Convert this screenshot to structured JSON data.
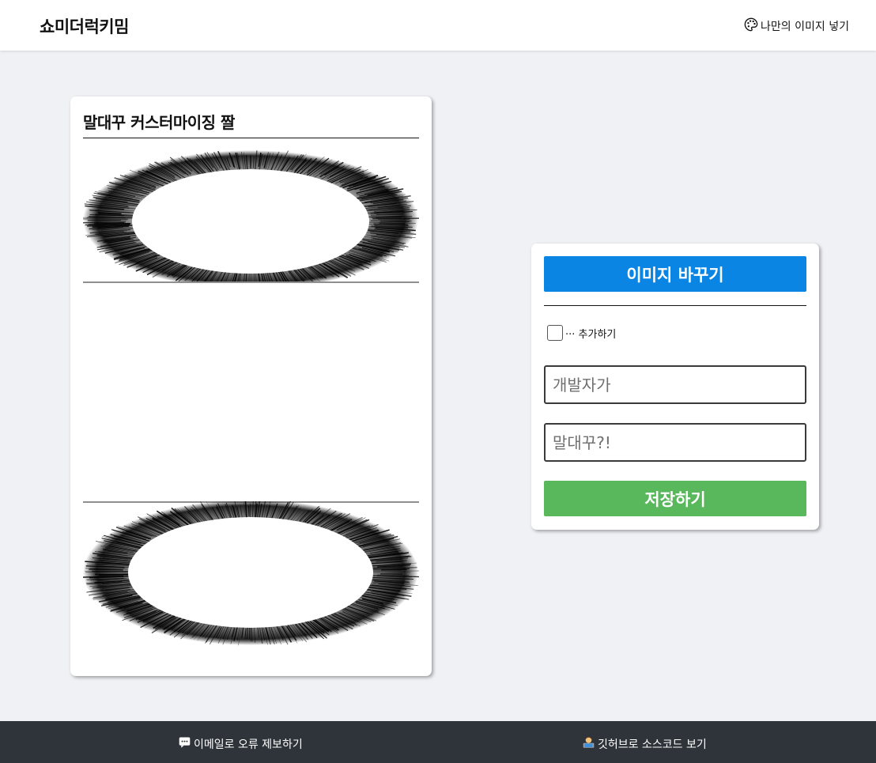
{
  "header": {
    "brand": "쇼미더럭키밈",
    "custom_image_link": "나만의 이미지 넣기",
    "custom_image_icon": "palette-icon"
  },
  "preview": {
    "title": "말대꾸 커스터마이징 짤"
  },
  "controls": {
    "change_image_label": "이미지 바꾸기",
    "add_ellipsis_label": "··· 추가하기",
    "add_ellipsis_checked": false,
    "top_text_placeholder": "개발자가",
    "top_text_value": "",
    "bottom_text_placeholder": "말대꾸?!",
    "bottom_text_value": "",
    "save_label": "저장하기"
  },
  "footer": {
    "report_label": "이메일로 오류 제보하기",
    "report_icon": "speech-bubble-icon",
    "github_label": "깃허브로 소스코드 보기",
    "github_icon": "technologist-icon"
  },
  "colors": {
    "primary_button": "#0a85e4",
    "save_button": "#59b75c",
    "page_background": "#eff1f5",
    "footer_background": "#2f343a"
  }
}
